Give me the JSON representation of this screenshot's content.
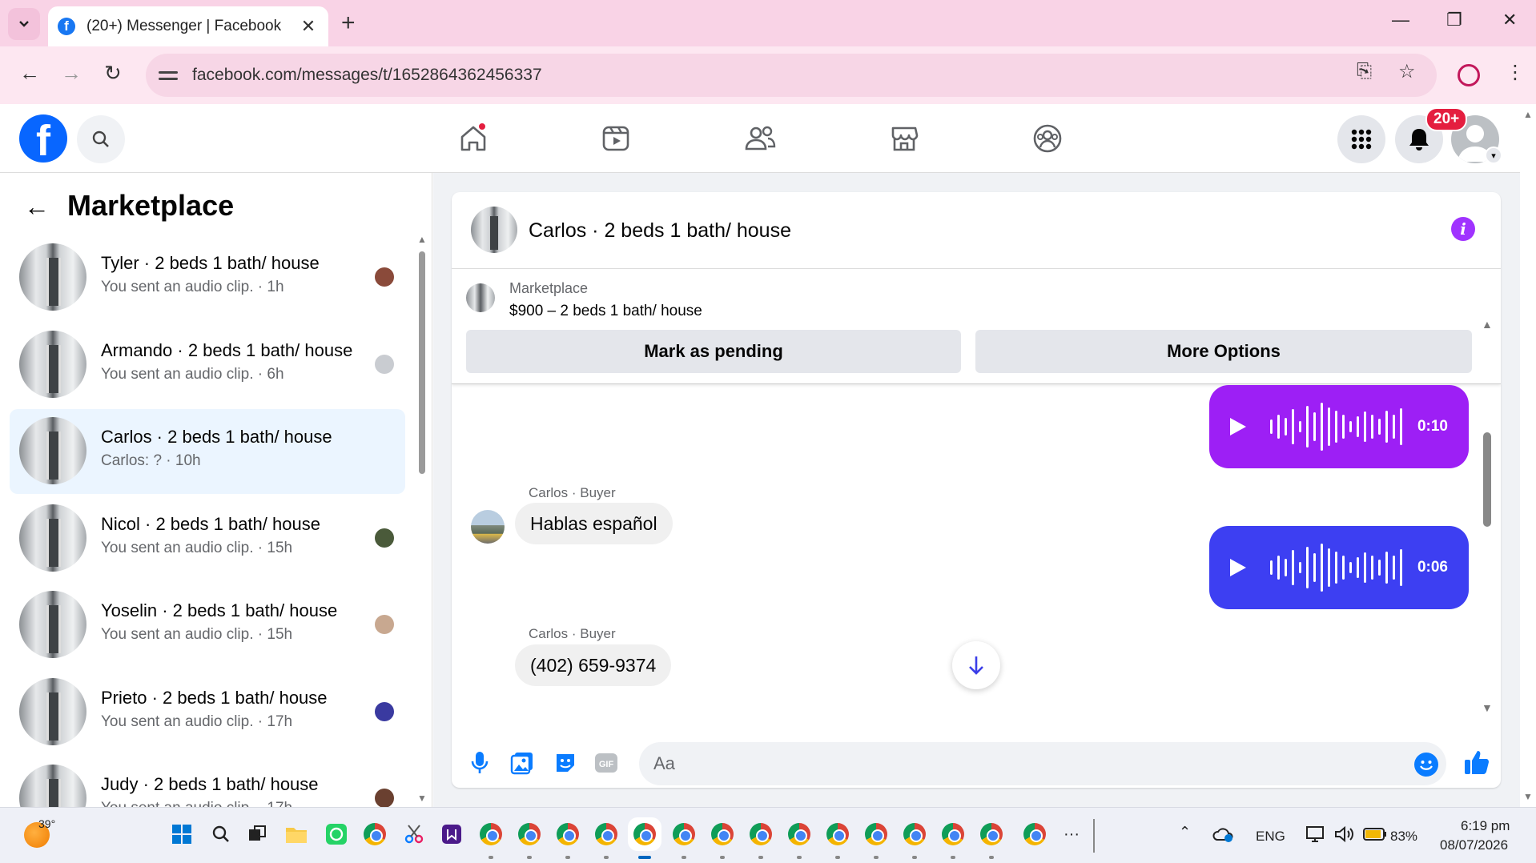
{
  "browser": {
    "tab_title": "(20+) Messenger | Facebook",
    "url": "facebook.com/messages/t/1652864362456337"
  },
  "header": {
    "notifications_badge": "20+"
  },
  "left_panel": {
    "title": "Marketplace",
    "conversations": [
      {
        "name": "Tyler · 2 beds 1 bath/ house",
        "sub": "You sent an audio clip. · 1h",
        "seen_color": "#8a4a3a"
      },
      {
        "name": "Armando · 2 beds 1 bath/ house",
        "sub": "You sent an audio clip. · 6h",
        "seen_color": "#c9ccd1"
      },
      {
        "name": "Carlos · 2 beds 1 bath/ house",
        "sub": "Carlos: ? · 10h",
        "seen_color": ""
      },
      {
        "name": "Nicol · 2 beds 1 bath/ house",
        "sub": "You sent an audio clip. · 15h",
        "seen_color": "#4a5a3a"
      },
      {
        "name": "Yoselin · 2 beds 1 bath/ house",
        "sub": "You sent an audio clip. · 15h",
        "seen_color": "#c8a890"
      },
      {
        "name": "Prieto · 2 beds 1 bath/ house",
        "sub": "You sent an audio clip. · 17h",
        "seen_color": "#3a3aa0"
      },
      {
        "name": "Judy · 2 beds 1 bath/ house",
        "sub": "You sent an audio clip. · 17h",
        "seen_color": "#6a4030"
      }
    ]
  },
  "chat": {
    "title": "Carlos · 2 beds 1 bath/ house",
    "listing": {
      "category": "Marketplace",
      "price_title": "$900 – 2 beds 1 bath/ house",
      "mark_pending": "Mark as pending",
      "more_options": "More Options"
    },
    "messages": [
      {
        "type": "audio_out",
        "duration": "0:10",
        "color": "#9d1ff5"
      },
      {
        "type": "text_in",
        "sender": "Carlos · Buyer",
        "text": "Hablas español"
      },
      {
        "type": "audio_out",
        "duration": "0:06",
        "color": "#3d3ff2"
      },
      {
        "type": "text_in",
        "sender": "Carlos · Buyer",
        "text": "(402) 659-9374"
      }
    ],
    "composer_placeholder": "Aa"
  },
  "taskbar": {
    "temperature": "39°",
    "language": "ENG",
    "battery": "83%",
    "time": "6:19 pm",
    "date": "08/07/2026"
  },
  "colors": {
    "fb_blue": "#0866ff",
    "accent_purple": "#a033ff",
    "active_row": "#ebf5ff"
  }
}
